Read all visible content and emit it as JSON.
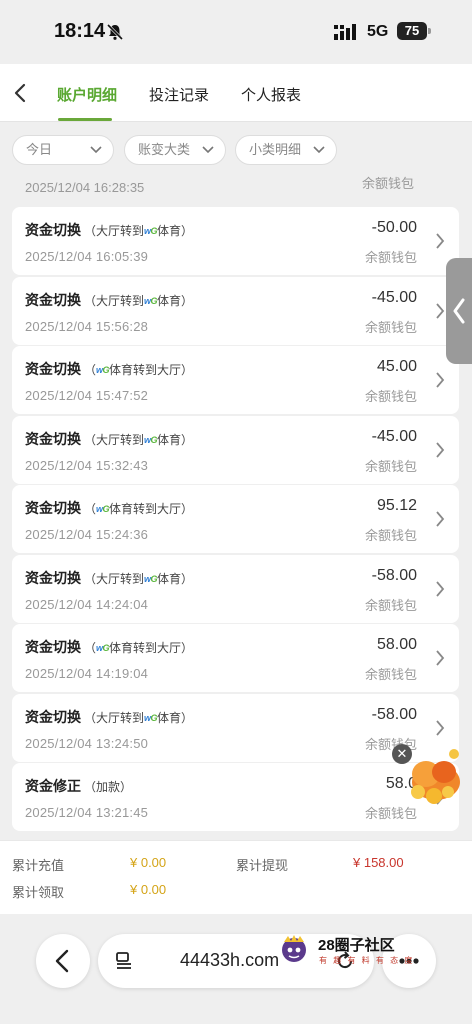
{
  "status_bar": {
    "time": "18:14",
    "network": "5G",
    "battery": "75"
  },
  "tabs": [
    {
      "label": "账户明细",
      "active": true
    },
    {
      "label": "投注记录",
      "active": false
    },
    {
      "label": "个人报表",
      "active": false
    }
  ],
  "filters": [
    {
      "label": "今日"
    },
    {
      "label": "账变大类"
    },
    {
      "label": "小类明细"
    }
  ],
  "partial_row": {
    "time": "2025/12/04 16:28:35",
    "wallet": "余额钱包"
  },
  "transactions": [
    {
      "title": "资金切换",
      "pre": "（大厅转到",
      "post": "体育）",
      "wg_first": false,
      "time": "2025/12/04 16:05:39",
      "amount": "-50.00",
      "wallet": "余额钱包"
    },
    {
      "title": "资金切换",
      "pre": "（大厅转到",
      "post": "体育）",
      "wg_first": false,
      "time": "2025/12/04 15:56:28",
      "amount": "-45.00",
      "wallet": "余额钱包"
    },
    {
      "title": "资金切换",
      "pre": "（",
      "post": "体育转到大厅）",
      "wg_first": true,
      "time": "2025/12/04 15:47:52",
      "amount": "45.00",
      "wallet": "余额钱包"
    },
    {
      "title": "资金切换",
      "pre": "（大厅转到",
      "post": "体育）",
      "wg_first": false,
      "time": "2025/12/04 15:32:43",
      "amount": "-45.00",
      "wallet": "余额钱包"
    },
    {
      "title": "资金切换",
      "pre": "（",
      "post": "体育转到大厅）",
      "wg_first": true,
      "time": "2025/12/04 15:24:36",
      "amount": "95.12",
      "wallet": "余额钱包"
    },
    {
      "title": "资金切换",
      "pre": "（大厅转到",
      "post": "体育）",
      "wg_first": false,
      "time": "2025/12/04 14:24:04",
      "amount": "-58.00",
      "wallet": "余额钱包"
    },
    {
      "title": "资金切换",
      "pre": "（",
      "post": "体育转到大厅）",
      "wg_first": true,
      "time": "2025/12/04 14:19:04",
      "amount": "58.00",
      "wallet": "余额钱包"
    },
    {
      "title": "资金切换",
      "pre": "（大厅转到",
      "post": "体育）",
      "wg_first": false,
      "time": "2025/12/04 13:24:50",
      "amount": "-58.00",
      "wallet": "余额钱包"
    },
    {
      "title": "资金修正",
      "pre": "（加款）",
      "post": "",
      "wg_first": null,
      "time": "2025/12/04 13:21:45",
      "amount": "58.0",
      "wallet": "余额钱包"
    }
  ],
  "wg_logo": {
    "w": "w",
    "g": "G"
  },
  "summary": {
    "recharge_label": "累计充值",
    "recharge_value": "¥ 0.00",
    "withdraw_label": "累计提现",
    "withdraw_value": "¥ 158.00",
    "claim_label": "累计领取",
    "claim_value": "¥ 0.00"
  },
  "browser": {
    "url": "44433h.com"
  },
  "watermark": {
    "title": "28圈子社区",
    "subtitle": "有 趣 有 料 有 态 度"
  },
  "colors": {
    "accent": "#5aa832",
    "amount_yellow": "#d4a417",
    "amount_red": "#c8352c"
  }
}
